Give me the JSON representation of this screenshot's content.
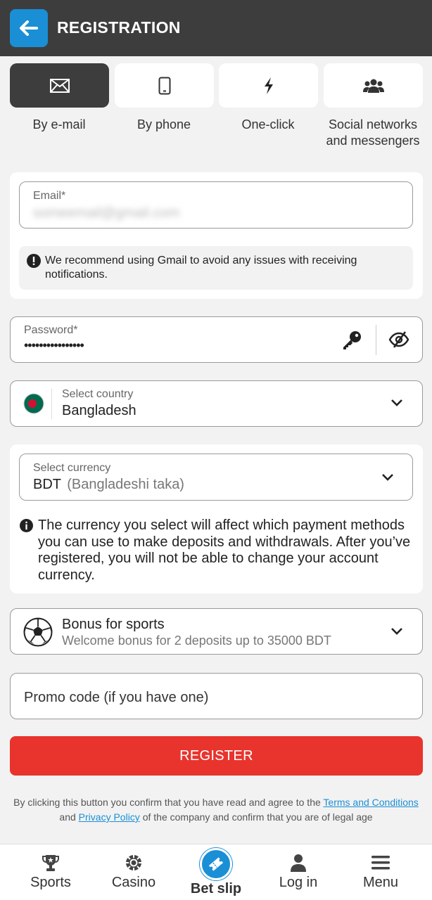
{
  "header": {
    "title": "REGISTRATION"
  },
  "tabs": [
    {
      "label": "By e-mail",
      "icon": "envelope-icon",
      "active": true
    },
    {
      "label": "By phone",
      "icon": "phone-icon",
      "active": false
    },
    {
      "label": "One-click",
      "icon": "lightning-icon",
      "active": false
    },
    {
      "label_line1": "Social networks",
      "label_line2": "and messengers",
      "icon": "users-icon",
      "active": false
    }
  ],
  "email": {
    "label": "Email*",
    "value": "someemail@gmail.com",
    "notice": "We recommend using Gmail to avoid any issues with receiving notifications."
  },
  "password": {
    "label": "Password*",
    "value": "••••••••••••••••"
  },
  "country": {
    "label": "Select country",
    "value": "Bangladesh"
  },
  "currency": {
    "label": "Select currency",
    "code": "BDT",
    "name": "(Bangladeshi taka)",
    "notice": "The currency you select will affect which payment methods you can use to make deposits and withdrawals. After you’ve registered, you will not be able to change your account currency."
  },
  "bonus": {
    "title": "Bonus for sports",
    "subtitle": "Welcome bonus for 2 deposits up to 35000 BDT"
  },
  "promo": {
    "placeholder": "Promo code (if you have one)"
  },
  "register_label": "REGISTER",
  "legal": {
    "part1": "By clicking this button you confirm that you have read and agree to the",
    "terms": "Terms and Conditions",
    "and": "and",
    "privacy": "Privacy Policy",
    "part2": "of the company and confirm that you are of legal age"
  },
  "nav": [
    {
      "label": "Sports",
      "icon": "trophy-icon"
    },
    {
      "label": "Casino",
      "icon": "casino-chip-icon"
    },
    {
      "label": "Bet slip",
      "icon": "ticket-icon"
    },
    {
      "label": "Log in",
      "icon": "user-icon"
    },
    {
      "label": "Menu",
      "icon": "hamburger-icon"
    }
  ],
  "colors": {
    "header": "#3d3d3d",
    "accent": "#1a8fd6",
    "register": "#e8342d",
    "flag_green": "#006a4e",
    "flag_red": "#d21034"
  }
}
